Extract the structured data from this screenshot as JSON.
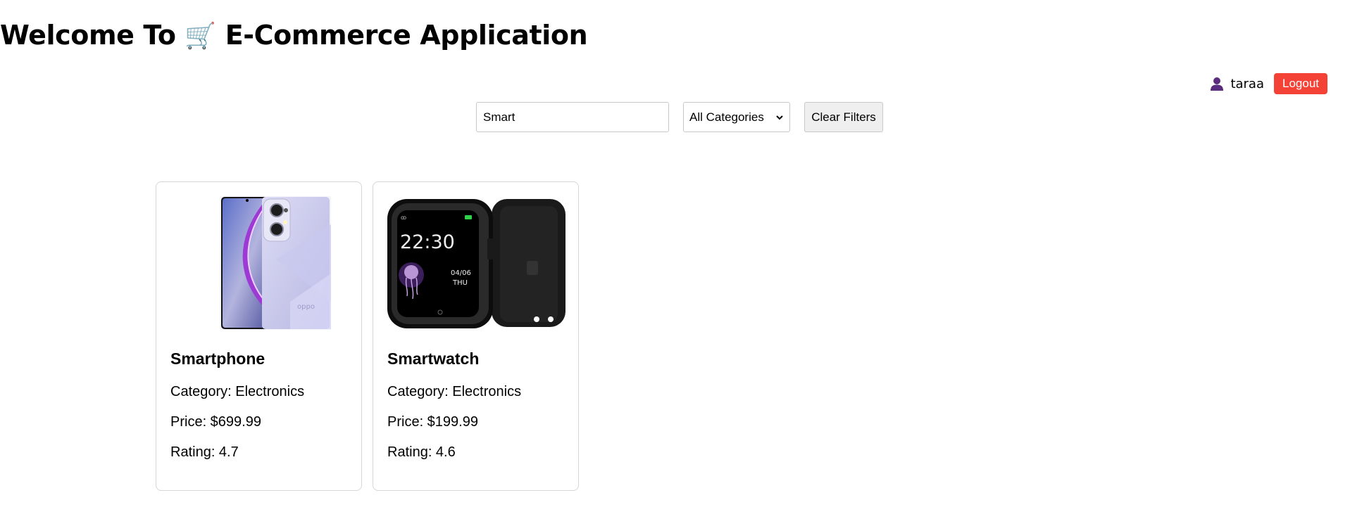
{
  "header": {
    "title_prefix": "Welcome To",
    "cart_emoji": "🛒",
    "title_suffix": "E-Commerce Application"
  },
  "user": {
    "icon": "user-icon",
    "name": "taraa",
    "logout_label": "Logout"
  },
  "filters": {
    "search_value": "Smart",
    "category_selected": "All Categories",
    "clear_label": "Clear Filters"
  },
  "colors": {
    "logout_bg": "#f44336",
    "user_icon": "#5b2d7e"
  },
  "products": [
    {
      "name": "Smartphone",
      "image": "smartphone-image",
      "category_line": "Category: Electronics",
      "price_line": "Price: $699.99",
      "rating_line": "Rating: 4.7"
    },
    {
      "name": "Smartwatch",
      "image": "smartwatch-image",
      "time": "22:30",
      "date": "04/06",
      "day": "THU",
      "category_line": "Category: Electronics",
      "price_line": "Price: $199.99",
      "rating_line": "Rating: 4.6"
    }
  ]
}
